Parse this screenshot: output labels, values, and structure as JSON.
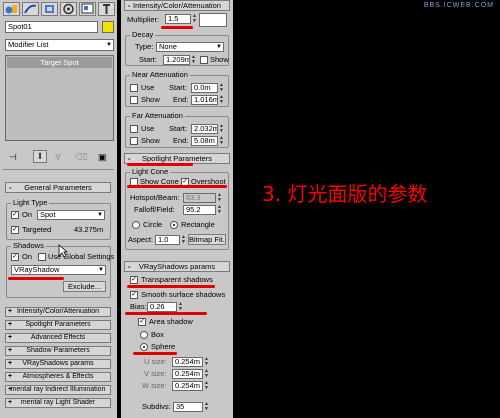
{
  "watermark": "BBS.ICWEB.COM",
  "overlay_text": "3. 灯光面版的参数",
  "colors": {
    "annotation_red": "#e00000",
    "panel_bg": "#c8c8c8",
    "swatch_yellow": "#f2e200",
    "text_red": "#ff0000"
  },
  "left_panel": {
    "toolbar_icons": [
      "create-icon",
      "modify-icon",
      "hierarchy-icon",
      "motion-icon",
      "display-icon",
      "utilities-icon"
    ],
    "object_name": "Spot01",
    "modifier_list": "Modifier List",
    "stack_item": "Target Spot",
    "stack_tools": [
      "pin-stack-icon",
      "show-end-result-icon",
      "make-unique-icon",
      "remove-modifier-icon",
      "configure-sets-icon"
    ],
    "general_params": {
      "title": "General Parameters",
      "light_type_label": "Light Type",
      "on_label": "On",
      "light_type_value": "Spot",
      "targeted_label": "Targeted",
      "target_distance": "43.275m",
      "shadows_label": "Shadows",
      "shadows_on_label": "On",
      "use_global_label": "Use Global Settings",
      "shadow_type": "VRayShadow",
      "exclude_label": "Exclude..."
    },
    "rollouts": [
      "Intensity/Color/Attenuation",
      "Spotlight Parameters",
      "Advanced Effects",
      "Shadow Parameters",
      "VRayShadows params",
      "Atmospheres & Effects",
      "mental ray Indirect Illumination",
      "mental ray Light Shader"
    ]
  },
  "right_panel": {
    "intensity": {
      "title": "Intensity/Color/Attenuation",
      "multiplier_label": "Multiplier:",
      "multiplier_value": "1.5",
      "decay_label": "Decay",
      "type_label": "Type:",
      "type_value": "None",
      "start_label": "Start:",
      "start_value": "1.209m",
      "show_label": "Show",
      "near_label": "Near Attenuation",
      "near_use": "Use",
      "near_start_label": "Start:",
      "near_start": "0.0m",
      "near_show": "Show",
      "near_end_label": "End:",
      "near_end": "1.016m",
      "far_label": "Far Attenuation",
      "far_use": "Use",
      "far_start_label": "Start:",
      "far_start": "2.032m",
      "far_show": "Show",
      "far_end_label": "End:",
      "far_end": "5.08m"
    },
    "spotlight": {
      "title": "Spotlight Parameters",
      "cone_label": "Light Cone",
      "show_cone_label": "Show Cone",
      "overshoot_label": "Overshoot",
      "hotspot_label": "Hotspot/Beam:",
      "hotspot_value": "63.3",
      "falloff_label": "Falloff/Field:",
      "falloff_value": "95.2",
      "circle_label": "Circle",
      "rectangle_label": "Rectangle",
      "aspect_label": "Aspect:",
      "aspect_value": "1.0",
      "bitmap_fit_label": "Bitmap Fit..."
    },
    "vray_shadows": {
      "title": "VRayShadows params",
      "transparent_label": "Transparent shadows",
      "smooth_label": "Smooth surface shadows",
      "bias_label": "Bias:",
      "bias_value": "0.26",
      "area_label": "Area shadow",
      "box_label": "Box",
      "sphere_label": "Sphere",
      "u_label": "U size:",
      "u_value": "0.254m",
      "v_label": "V size:",
      "v_value": "0.254m",
      "w_label": "W size:",
      "w_value": "0.254m",
      "subdivs_label": "Subdivs:",
      "subdivs_value": "35"
    }
  }
}
